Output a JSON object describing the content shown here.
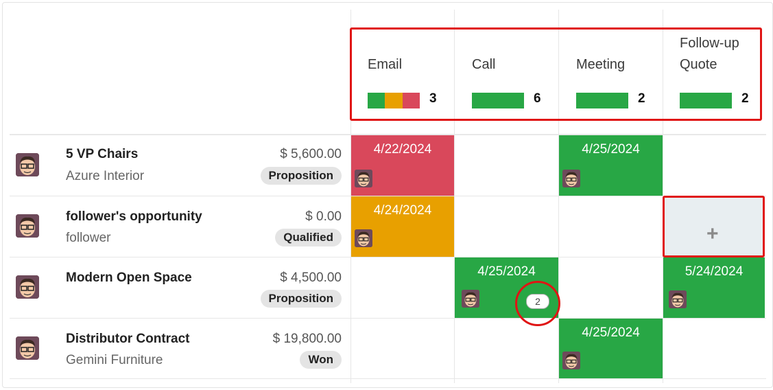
{
  "columns": [
    {
      "title": "Email",
      "count": "3",
      "bar": [
        {
          "color": "#28a745",
          "flex": 1
        },
        {
          "color": "#e8a000",
          "flex": 1
        },
        {
          "color": "#d9485b",
          "flex": 1
        }
      ]
    },
    {
      "title": "Call",
      "count": "6",
      "bar": [
        {
          "color": "#28a745",
          "flex": 1
        }
      ]
    },
    {
      "title": "Meeting",
      "count": "2",
      "bar": [
        {
          "color": "#28a745",
          "flex": 1
        }
      ]
    },
    {
      "title_line1": "Follow-up",
      "title_line2": "Quote",
      "count": "2",
      "bar": [
        {
          "color": "#28a745",
          "flex": 1
        }
      ]
    }
  ],
  "records": [
    {
      "title": "5 VP Chairs",
      "subtitle": "Azure Interior",
      "amount": "$ 5,600.00",
      "stage": "Proposition"
    },
    {
      "title": "follower's opportunity",
      "subtitle": "follower",
      "amount": "$ 0.00",
      "stage": "Qualified"
    },
    {
      "title": "Modern Open Space",
      "subtitle": "",
      "amount": "$ 4,500.00",
      "stage": "Proposition"
    },
    {
      "title": "Distributor Contract",
      "subtitle": "Gemini Furniture",
      "amount": "$ 19,800.00",
      "stage": "Won"
    }
  ],
  "cells": {
    "r0_email": {
      "date": "4/22/2024",
      "color": "#d9485b"
    },
    "r0_meeting": {
      "date": "4/25/2024",
      "color": "#28a745"
    },
    "r1_email": {
      "date": "4/24/2024",
      "color": "#e8a000"
    },
    "r1_followup": {
      "empty_action": "+"
    },
    "r2_call": {
      "date": "4/25/2024",
      "color": "#28a745",
      "extra_count": "2"
    },
    "r2_followup": {
      "date": "5/24/2024",
      "color": "#28a745"
    },
    "r3_meeting": {
      "date": "4/25/2024",
      "color": "#28a745"
    }
  },
  "icons": {
    "avatar": "user-avatar-icon",
    "add": "plus-icon"
  },
  "colors": {
    "overdue": "#d9485b",
    "today": "#e8a000",
    "planned": "#28a745",
    "highlight": "#e01414"
  }
}
